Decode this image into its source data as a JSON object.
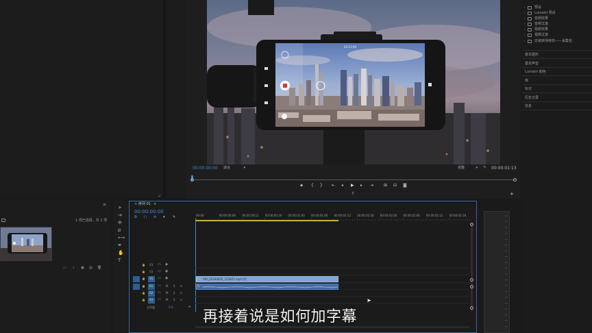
{
  "effects_panel": {
    "folders": [
      "预设",
      "Lumetri 预设",
      "音频效果",
      "音频过渡",
      "视频效果",
      "视频过渡",
      "无缝转场特效——采集包"
    ],
    "sections": [
      "基本图形",
      "基本声音",
      "Lumetri 颜色",
      "库",
      "标记",
      "历史记录",
      "信息"
    ]
  },
  "program_monitor": {
    "timecode": "00:00:00:00",
    "fit_label": "适合",
    "quality_label": "完整",
    "duration": "00:00:01:13",
    "phone_time": "03:21:49"
  },
  "project_panel": {
    "status": "1 项已选择，共 2 项"
  },
  "timeline": {
    "sequence_name": "序列 01",
    "timecode": "00:00:00:00",
    "ruler_ticks": [
      "00:00",
      "00:00:00:06",
      "00:00:00:12",
      "00:00:00:18",
      "00:00:01:00",
      "00:00:01:06",
      "00:00:01:12",
      "00:00:01:18",
      "00:00:02:00",
      "00:00:02:06",
      "00:00:02:12",
      "00:00:02:18",
      "00:"
    ],
    "video_tracks": [
      "V3",
      "V2",
      "V1"
    ],
    "audio_tracks": [
      "A1",
      "A2",
      "A3"
    ],
    "master_label": "主声道",
    "master_value": "0.0",
    "clip_name": "VID_20180620_152825.mp4 [V]"
  },
  "subtitle": "再接着说是如何加字幕",
  "colors": {
    "accent_blue": "#3b8ed8",
    "clip_video": "#7fa5d6",
    "clip_audio": "#3f6aa5"
  }
}
